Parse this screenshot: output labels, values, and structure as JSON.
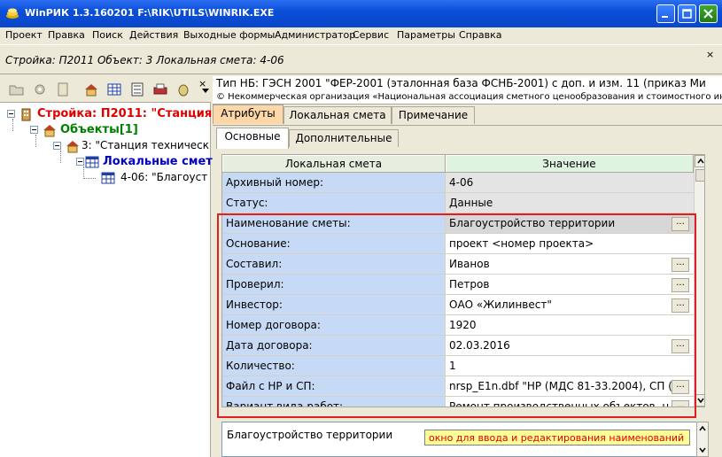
{
  "window": {
    "title": "WinPИК 1.3.160201   F:\\RIK\\UTILS\\WINRIK.EXE"
  },
  "menu": [
    "Проект",
    "Правка",
    "Поиск",
    "Действия",
    "Выходные формы",
    "Администратор",
    "Сервис",
    "Параметры",
    "Справка"
  ],
  "context": {
    "text": "Стройка: П2011  Объект: 3  Локальная смета: 4-06",
    "close": "×"
  },
  "tree": {
    "items": [
      {
        "label": "Стройка: П2011: \"Станция"
      },
      {
        "label": "Объекты[1]"
      },
      {
        "label": "3: \"Станция техническ"
      },
      {
        "label": "Локальные смет"
      },
      {
        "label": "4-06: \"Благоуст"
      }
    ],
    "close": "×"
  },
  "info": {
    "nb_type": "Тип НБ: ГЭСН 2001 \"ФЕР-2001 (эталонная база ФСНБ-2001) с доп. и изм. 11 (приказ Ми",
    "org": "© Некоммерческая организация «Национальная ассоциация сметного ценообразования и стоимостного инж"
  },
  "tabs": [
    {
      "label": "Атрибуты"
    },
    {
      "label": "Локальная смета"
    },
    {
      "label": "Примечание"
    }
  ],
  "subtabs": [
    {
      "label": "Основные"
    },
    {
      "label": "Дополнительные"
    }
  ],
  "grid": {
    "col_name": "Локальная смета",
    "col_value": "Значение",
    "dots": "...",
    "rows": [
      {
        "name": "Архивный номер:",
        "value": "4-06"
      },
      {
        "name": "Статус:",
        "value": "Данные"
      },
      {
        "name": "Наименование сметы:",
        "value": "Благоустройство территории"
      },
      {
        "name": "Основание:",
        "value": "проект <номер проекта>"
      },
      {
        "name": "Составил:",
        "value": "Иванов"
      },
      {
        "name": "Проверил:",
        "value": "Петров"
      },
      {
        "name": "Инвестор:",
        "value": "ОАО «Жилинвест\""
      },
      {
        "name": "Номер договора:",
        "value": "1920"
      },
      {
        "name": "Дата договора:",
        "value": "02.03.2016"
      },
      {
        "name": "Количество:",
        "value": "1"
      },
      {
        "name": "Файл с НР и СП:",
        "value": "nrsp_E1n.dbf  \"НР (МДС 81-33.2004), СП (П"
      },
      {
        "name": "Вариант вида работ:",
        "value": "Ремонт производственных объектов, н"
      }
    ]
  },
  "description": {
    "text": "Благоустройство территории",
    "hint": "окно для ввода и редактирования наименований"
  },
  "colors": {
    "titlebar": "#0a4fd8",
    "accent_tab": "#fdd7a8",
    "name_col": "#c6daf5",
    "highlight": "#e02020",
    "hint_bg": "#ffff99"
  }
}
